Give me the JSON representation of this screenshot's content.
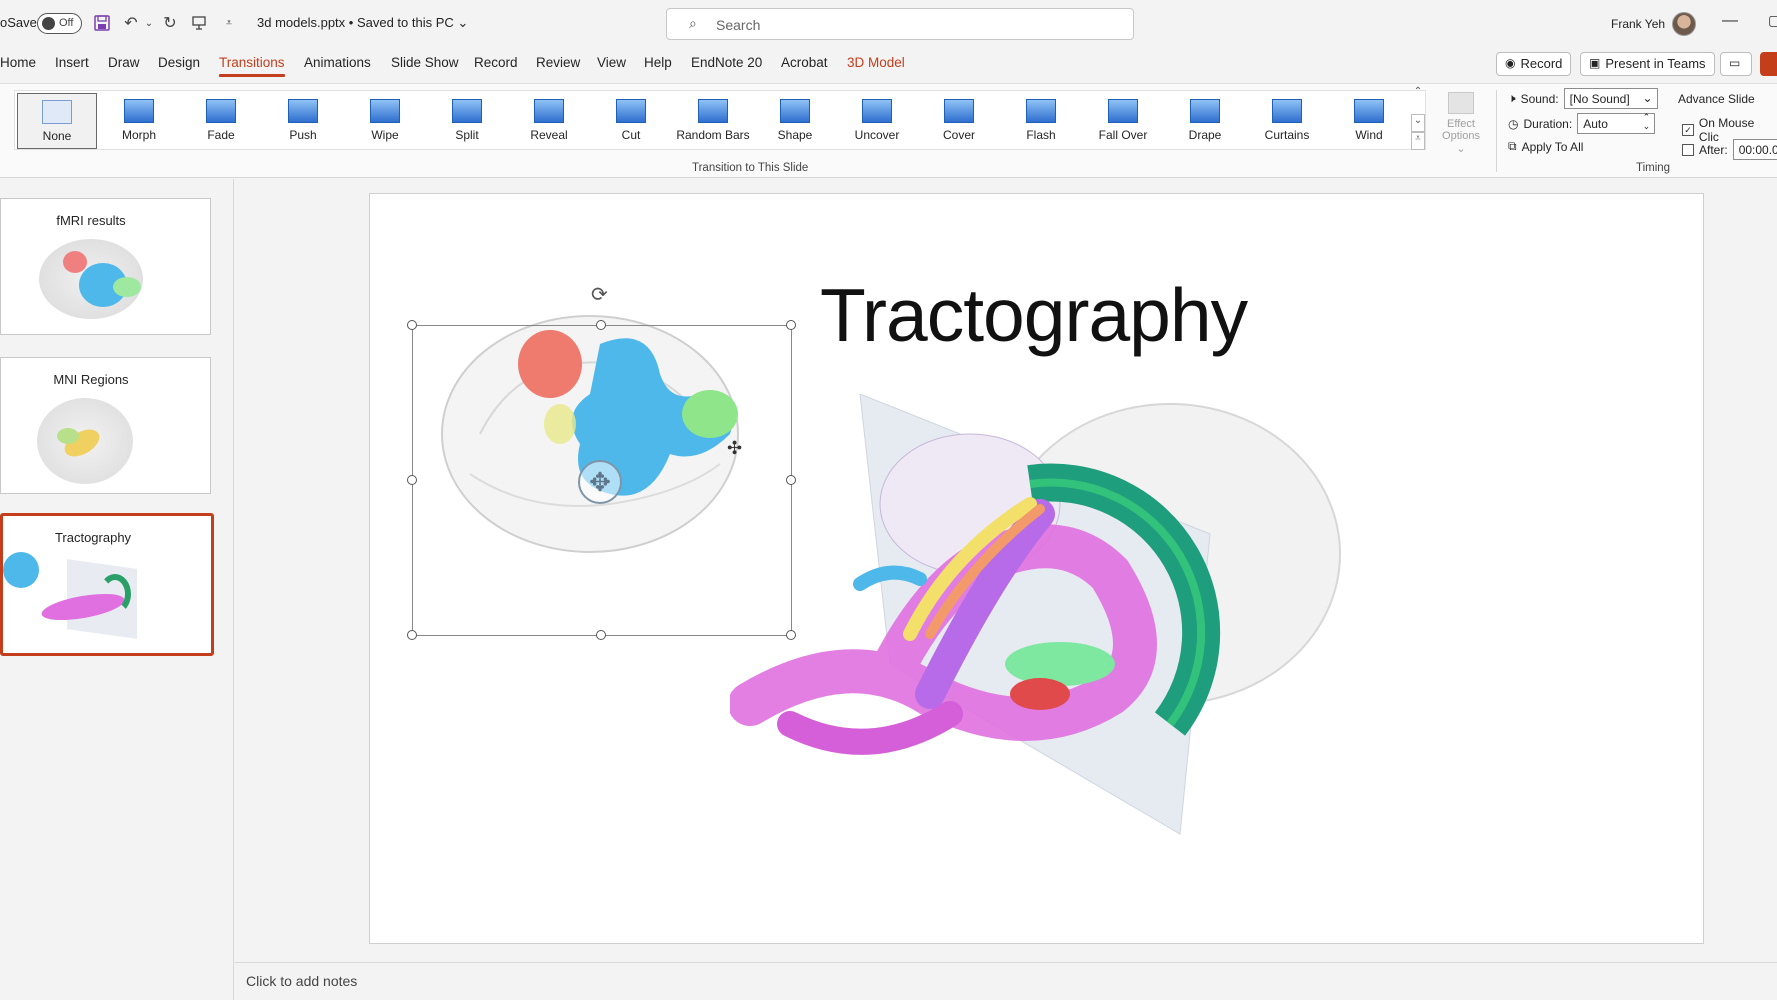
{
  "titlebar": {
    "autosave_label": "oSave",
    "autosave_state": "Off",
    "filename": "3d models.pptx  •  Saved to this PC",
    "search_placeholder": "Search",
    "username": "Frank Yeh"
  },
  "tabs": [
    "Home",
    "Insert",
    "Draw",
    "Design",
    "Transitions",
    "Animations",
    "Slide Show",
    "Record",
    "Review",
    "View",
    "Help",
    "EndNote 20",
    "Acrobat",
    "3D Model"
  ],
  "active_tab": "Transitions",
  "header_buttons": {
    "record": "Record",
    "present": "Present in Teams"
  },
  "gallery": {
    "items": [
      "None",
      "Morph",
      "Fade",
      "Push",
      "Wipe",
      "Split",
      "Reveal",
      "Cut",
      "Random Bars",
      "Shape",
      "Uncover",
      "Cover",
      "Flash",
      "Fall Over",
      "Drape",
      "Curtains",
      "Wind"
    ],
    "selected": "None",
    "group_label": "Transition to This Slide"
  },
  "effect_options": {
    "line1": "Effect",
    "line2": "Options"
  },
  "timing": {
    "sound_label": "Sound:",
    "sound_value": "[No Sound]",
    "duration_label": "Duration:",
    "duration_value": "Auto",
    "apply_all": "Apply To All",
    "advance_label": "Advance Slide",
    "on_mouse_click": "On Mouse Clic",
    "on_mouse_click_checked": true,
    "after_label": "After:",
    "after_value": "00:00.0",
    "after_checked": false,
    "group_label": "Timing"
  },
  "slides": [
    {
      "title": "fMRI results",
      "selected": false
    },
    {
      "title": "MNI Regions",
      "selected": false
    },
    {
      "title": "Tractography",
      "selected": true
    }
  ],
  "slide": {
    "title": "Tractography"
  },
  "notes_placeholder": "Click to add notes",
  "colors": {
    "accent": "#c43e1c",
    "brain_blue": "#4fb8ea",
    "tract_pink": "#e070e0"
  }
}
